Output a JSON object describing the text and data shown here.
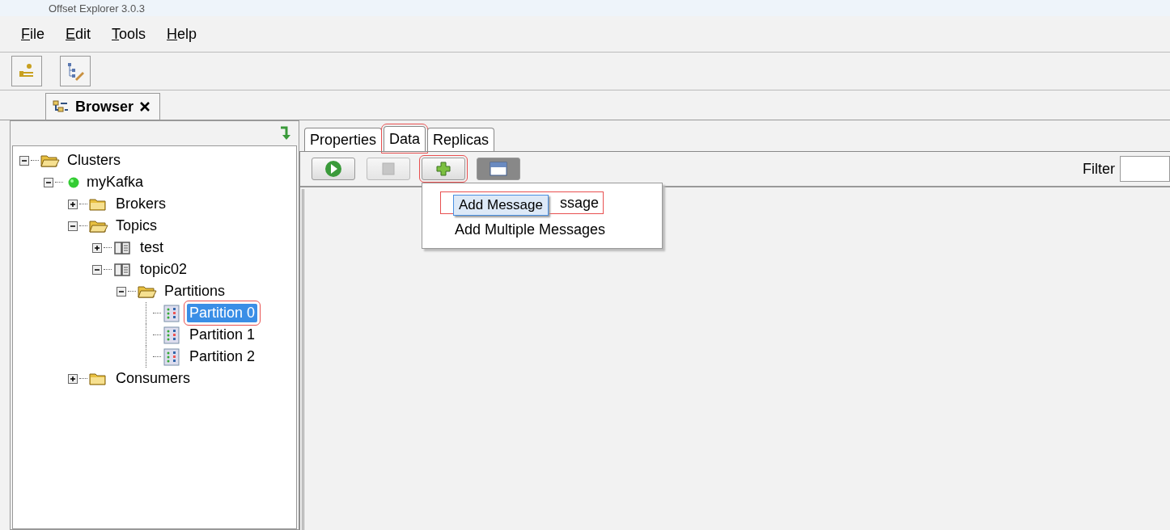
{
  "window": {
    "title": "Offset Explorer 3.0.3"
  },
  "menu": [
    {
      "label": "File"
    },
    {
      "label": "Edit"
    },
    {
      "label": "Tools"
    },
    {
      "label": "Help"
    }
  ],
  "editor_tab": {
    "label": "Browser"
  },
  "tree": [
    {
      "label": "Clusters",
      "kind": "folder",
      "expanded": true,
      "selected": false,
      "highlighted": false,
      "children": [
        {
          "label": "myKafka",
          "kind": "server",
          "expanded": true,
          "selected": false,
          "highlighted": false,
          "children": [
            {
              "label": "Brokers",
              "kind": "folder",
              "expanded": false,
              "selected": false,
              "highlighted": false
            },
            {
              "label": "Topics",
              "kind": "folder",
              "expanded": true,
              "selected": false,
              "highlighted": false,
              "children": [
                {
                  "label": "test",
                  "kind": "topic",
                  "expanded": false,
                  "selected": false,
                  "highlighted": false
                },
                {
                  "label": "topic02",
                  "kind": "topic",
                  "expanded": true,
                  "selected": false,
                  "highlighted": false,
                  "children": [
                    {
                      "label": "Partitions",
                      "kind": "folder",
                      "expanded": true,
                      "selected": false,
                      "highlighted": false,
                      "children": [
                        {
                          "label": "Partition 0",
                          "kind": "partition",
                          "selected": true,
                          "highlighted": true
                        },
                        {
                          "label": "Partition 1",
                          "kind": "partition",
                          "selected": false,
                          "highlighted": false
                        },
                        {
                          "label": "Partition 2",
                          "kind": "partition",
                          "selected": false,
                          "highlighted": false
                        }
                      ]
                    }
                  ]
                }
              ]
            },
            {
              "label": "Consumers",
              "kind": "folder",
              "expanded": false,
              "selected": false,
              "highlighted": false
            }
          ]
        }
      ]
    }
  ],
  "tabs": [
    {
      "label": "Properties",
      "selected": false,
      "highlighted": false
    },
    {
      "label": "Data",
      "selected": true,
      "highlighted": true
    },
    {
      "label": "Replicas",
      "selected": false,
      "highlighted": false
    }
  ],
  "toolbar": [
    {
      "kind": "play",
      "disabled": false,
      "highlighted": false
    },
    {
      "kind": "stop",
      "disabled": true,
      "highlighted": false
    },
    {
      "kind": "add",
      "disabled": false,
      "highlighted": true
    },
    {
      "kind": "view",
      "disabled": false,
      "highlighted": false
    }
  ],
  "filter": {
    "label": "Filter"
  },
  "popup_menu": {
    "items": [
      {
        "label": "ssage",
        "highlighted": true
      },
      {
        "label": "Add Multiple Messages",
        "highlighted": false
      }
    ],
    "drag_label": "Add Message"
  }
}
